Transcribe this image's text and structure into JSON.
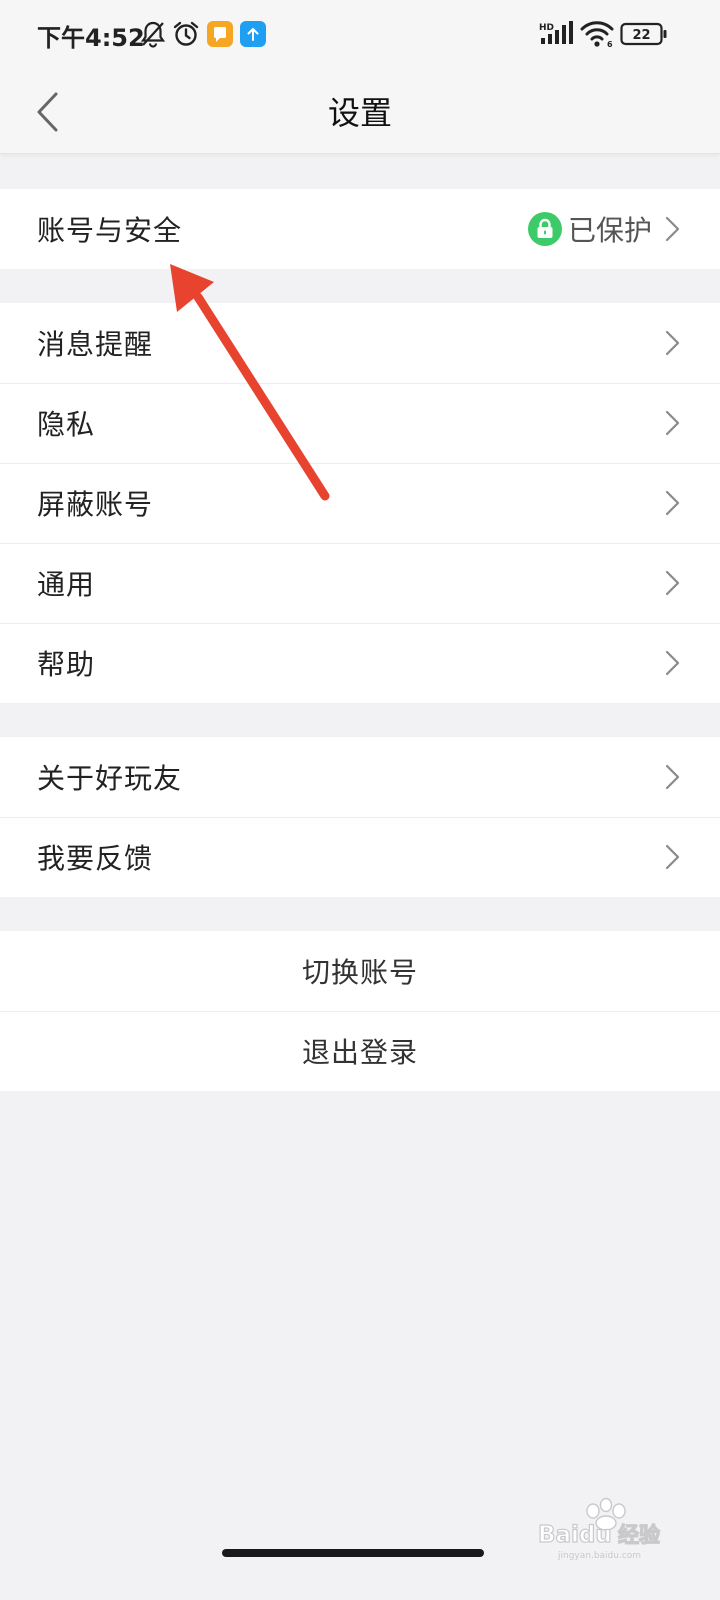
{
  "status_bar": {
    "time": "下午4:52",
    "network_label": "HD",
    "battery_level": "22",
    "icons": [
      "bell-off-icon",
      "alarm-clock-icon",
      "orange-app-icon",
      "blue-upload-app-icon",
      "signal-icon",
      "wifi-icon",
      "battery-icon"
    ],
    "app_icon_colors": {
      "orange": "#f5a623",
      "blue": "#1e9ff2"
    }
  },
  "header": {
    "title": "设置",
    "back_icon": "chevron-left-icon"
  },
  "account_group": {
    "label": "账号与安全",
    "status_text": "已保护",
    "status_icon": "lock-icon",
    "status_color": "#3ccb68"
  },
  "settings_group": {
    "items": [
      {
        "label": "消息提醒"
      },
      {
        "label": "隐私"
      },
      {
        "label": "屏蔽账号"
      },
      {
        "label": "通用"
      },
      {
        "label": "帮助"
      }
    ]
  },
  "about_group": {
    "items": [
      {
        "label": "关于好玩友"
      },
      {
        "label": "我要反馈"
      }
    ]
  },
  "action_group": {
    "switch_account": "切换账号",
    "logout": "退出登录"
  },
  "annotation": {
    "arrow_color": "#e8432f"
  },
  "watermark": {
    "brand": "Baidu",
    "tag": "经验",
    "domain": "jingyan.baidu.com"
  }
}
